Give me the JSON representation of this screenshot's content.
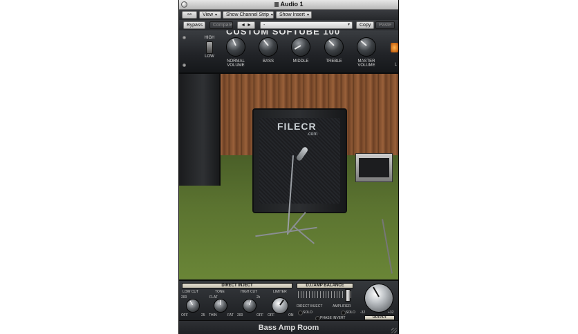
{
  "window": {
    "title": "Audio 1"
  },
  "toolbar": {
    "view_label": "View",
    "channel_strip_label": "Show Channel Strip",
    "insert_label": "Show Insert",
    "bypass_label": "Bypass",
    "compare_label": "Compare",
    "prev_next_label": "◄ ►",
    "preset_value": "-",
    "copy_label": "Copy",
    "paste_label": "Paste"
  },
  "amp": {
    "brand": "CUSTOM SOFTUBE 100",
    "switch_high": "HIGH",
    "switch_low": "LOW",
    "knobs": [
      {
        "label": "NORMAL VOLUME"
      },
      {
        "label": "BASS"
      },
      {
        "label": "MIDDLE"
      },
      {
        "label": "TREBLE"
      },
      {
        "label": "MASTER VOLUME"
      }
    ],
    "cut_label": "L"
  },
  "room": {
    "watermark": "FILECR",
    "watermark_sub": ".com"
  },
  "direct_inject": {
    "title": "DIRECT INJECT",
    "low_cut": {
      "label": "LOW CUT",
      "min": "200",
      "mid": "25",
      "max": "OFF"
    },
    "tone": {
      "label": "TONE",
      "top": "FLAT",
      "left": "THIN",
      "right": "FAT"
    },
    "high_cut": {
      "label": "HIGH CUT",
      "top": "2k",
      "left": "200",
      "right": "OFF"
    },
    "limiter": {
      "label": "LIMITER",
      "left": "OFF",
      "right": "ON"
    }
  },
  "balance": {
    "title": "D.I./AMP BALANCE",
    "left": "DIRECT INJECT",
    "right": "AMPLIFIER",
    "solo_left": "SOLO",
    "solo_right": "SOLO",
    "phase": "PHASE INVERT"
  },
  "output": {
    "label": "OUTPUT",
    "min": "-32",
    "max": "+32"
  },
  "footer": {
    "plugin_name": "Bass Amp Room"
  }
}
